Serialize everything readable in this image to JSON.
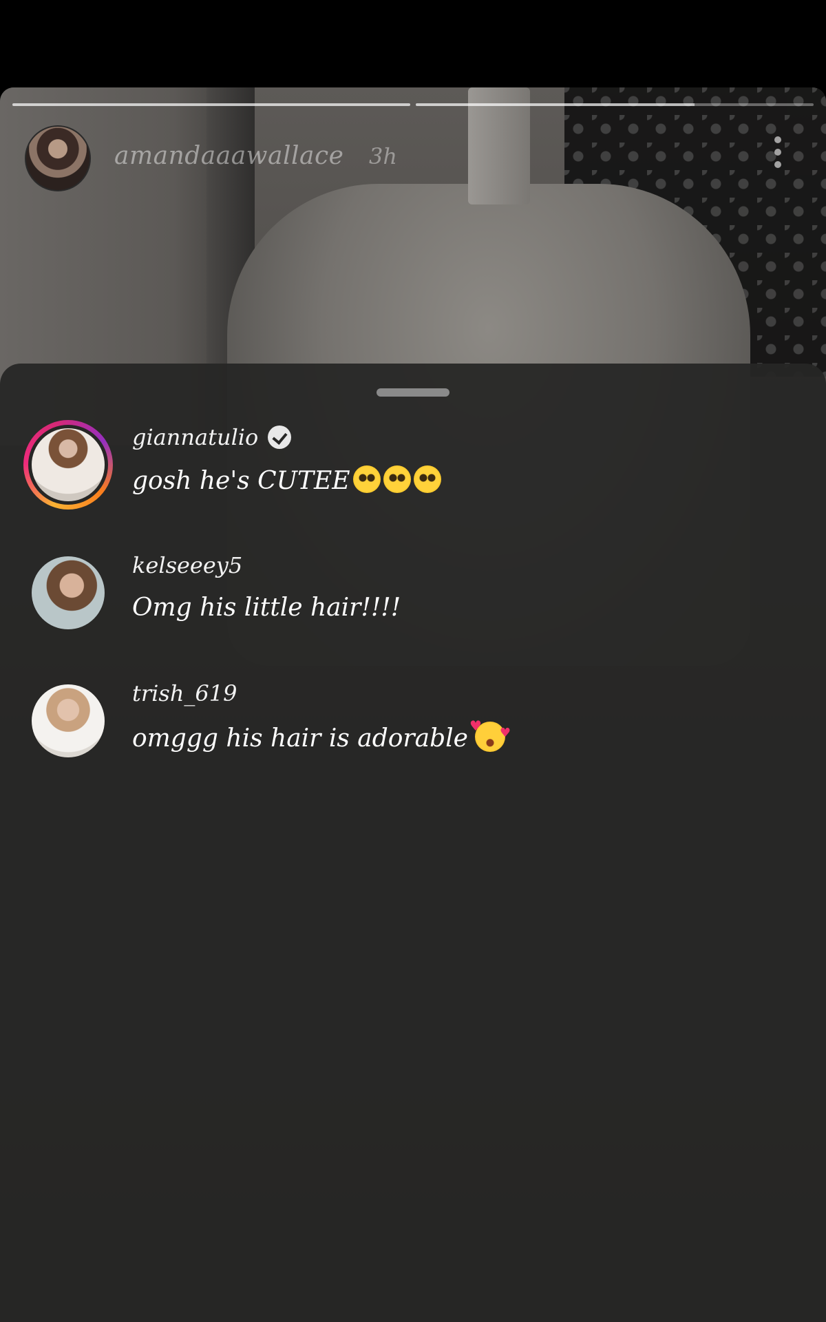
{
  "story": {
    "username": "amandaaawallace",
    "time": "3h",
    "progress": [
      1.0,
      0.7
    ]
  },
  "replies": [
    {
      "username": "giannatulio",
      "verified": true,
      "message": "gosh he's CUTEE",
      "emoji": [
        "pleading-face",
        "pleading-face",
        "pleading-face"
      ]
    },
    {
      "username": "kelseeey5",
      "verified": false,
      "message": "Omg his little hair!!!!"
    },
    {
      "username": "trish_619",
      "verified": false,
      "message": "omggg his hair is adorable",
      "emoji": [
        "smiling-face-with-hearts"
      ]
    }
  ],
  "colors": {
    "sheet_bg": "#262625",
    "story_ring": [
      "#f9b233",
      "#ee2a7b",
      "#962fbf"
    ]
  }
}
